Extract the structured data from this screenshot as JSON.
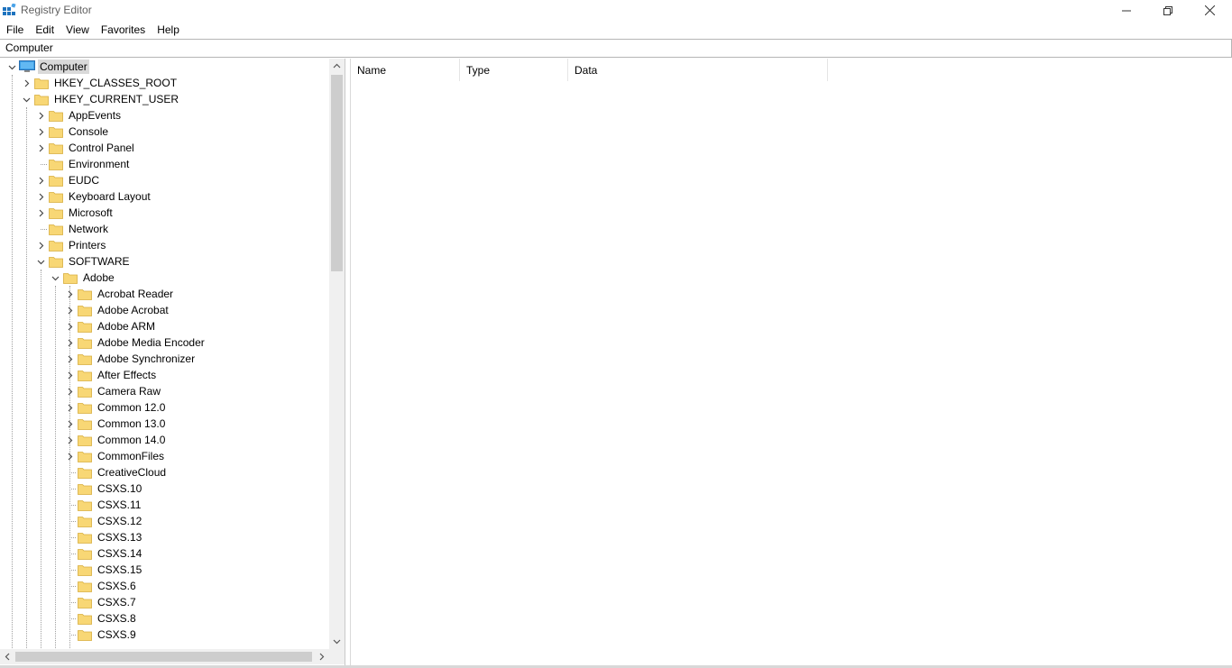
{
  "window": {
    "title": "Registry Editor",
    "icon": "registry-icon",
    "controls": {
      "minimize": "minimize-icon",
      "maximize": "restore-icon",
      "close": "close-icon"
    }
  },
  "menu": [
    "File",
    "Edit",
    "View",
    "Favorites",
    "Help"
  ],
  "address": "Computer",
  "tree": {
    "root": "Computer",
    "hives": [
      "HKEY_CLASSES_ROOT",
      "HKEY_CURRENT_USER"
    ],
    "hkcu_children": [
      "AppEvents",
      "Console",
      "Control Panel",
      "Environment",
      "EUDC",
      "Keyboard Layout",
      "Microsoft",
      "Network",
      "Printers",
      "SOFTWARE"
    ],
    "software_children": [
      "Adobe"
    ],
    "adobe_children": [
      "Acrobat Reader",
      "Adobe Acrobat",
      "Adobe ARM",
      "Adobe Media Encoder",
      "Adobe Synchronizer",
      "After Effects",
      "Camera Raw",
      "Common 12.0",
      "Common 13.0",
      "Common 14.0",
      "CommonFiles",
      "CreativeCloud",
      "CSXS.10",
      "CSXS.11",
      "CSXS.12",
      "CSXS.13",
      "CSXS.14",
      "CSXS.15",
      "CSXS.6",
      "CSXS.7",
      "CSXS.8",
      "CSXS.9"
    ]
  },
  "columns": {
    "name": "Name",
    "type": "Type",
    "data": "Data"
  },
  "colors": {
    "folder": "#f8d775",
    "selection": "#d9d9d9",
    "scrollbar_track": "#f0f0f0",
    "scrollbar_thumb": "#cdcdcd"
  }
}
